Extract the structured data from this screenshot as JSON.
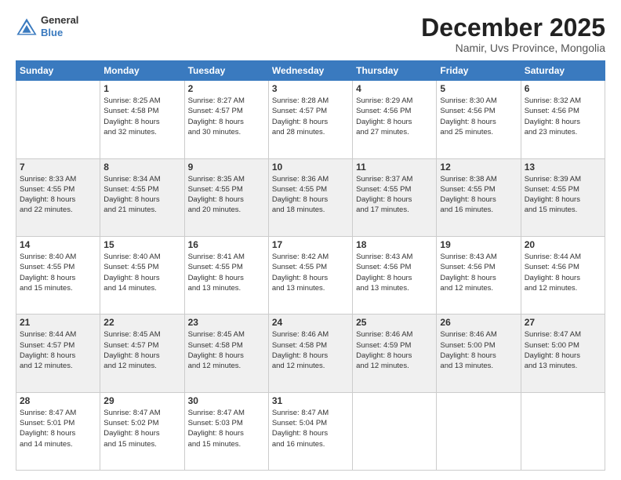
{
  "header": {
    "logo_general": "General",
    "logo_blue": "Blue",
    "month_title": "December 2025",
    "location": "Namir, Uvs Province, Mongolia"
  },
  "days_of_week": [
    "Sunday",
    "Monday",
    "Tuesday",
    "Wednesday",
    "Thursday",
    "Friday",
    "Saturday"
  ],
  "weeks": [
    [
      {
        "day": "",
        "content": ""
      },
      {
        "day": "1",
        "content": "Sunrise: 8:25 AM\nSunset: 4:58 PM\nDaylight: 8 hours\nand 32 minutes."
      },
      {
        "day": "2",
        "content": "Sunrise: 8:27 AM\nSunset: 4:57 PM\nDaylight: 8 hours\nand 30 minutes."
      },
      {
        "day": "3",
        "content": "Sunrise: 8:28 AM\nSunset: 4:57 PM\nDaylight: 8 hours\nand 28 minutes."
      },
      {
        "day": "4",
        "content": "Sunrise: 8:29 AM\nSunset: 4:56 PM\nDaylight: 8 hours\nand 27 minutes."
      },
      {
        "day": "5",
        "content": "Sunrise: 8:30 AM\nSunset: 4:56 PM\nDaylight: 8 hours\nand 25 minutes."
      },
      {
        "day": "6",
        "content": "Sunrise: 8:32 AM\nSunset: 4:56 PM\nDaylight: 8 hours\nand 23 minutes."
      }
    ],
    [
      {
        "day": "7",
        "content": "Sunrise: 8:33 AM\nSunset: 4:55 PM\nDaylight: 8 hours\nand 22 minutes."
      },
      {
        "day": "8",
        "content": "Sunrise: 8:34 AM\nSunset: 4:55 PM\nDaylight: 8 hours\nand 21 minutes."
      },
      {
        "day": "9",
        "content": "Sunrise: 8:35 AM\nSunset: 4:55 PM\nDaylight: 8 hours\nand 20 minutes."
      },
      {
        "day": "10",
        "content": "Sunrise: 8:36 AM\nSunset: 4:55 PM\nDaylight: 8 hours\nand 18 minutes."
      },
      {
        "day": "11",
        "content": "Sunrise: 8:37 AM\nSunset: 4:55 PM\nDaylight: 8 hours\nand 17 minutes."
      },
      {
        "day": "12",
        "content": "Sunrise: 8:38 AM\nSunset: 4:55 PM\nDaylight: 8 hours\nand 16 minutes."
      },
      {
        "day": "13",
        "content": "Sunrise: 8:39 AM\nSunset: 4:55 PM\nDaylight: 8 hours\nand 15 minutes."
      }
    ],
    [
      {
        "day": "14",
        "content": "Sunrise: 8:40 AM\nSunset: 4:55 PM\nDaylight: 8 hours\nand 15 minutes."
      },
      {
        "day": "15",
        "content": "Sunrise: 8:40 AM\nSunset: 4:55 PM\nDaylight: 8 hours\nand 14 minutes."
      },
      {
        "day": "16",
        "content": "Sunrise: 8:41 AM\nSunset: 4:55 PM\nDaylight: 8 hours\nand 13 minutes."
      },
      {
        "day": "17",
        "content": "Sunrise: 8:42 AM\nSunset: 4:55 PM\nDaylight: 8 hours\nand 13 minutes."
      },
      {
        "day": "18",
        "content": "Sunrise: 8:43 AM\nSunset: 4:56 PM\nDaylight: 8 hours\nand 13 minutes."
      },
      {
        "day": "19",
        "content": "Sunrise: 8:43 AM\nSunset: 4:56 PM\nDaylight: 8 hours\nand 12 minutes."
      },
      {
        "day": "20",
        "content": "Sunrise: 8:44 AM\nSunset: 4:56 PM\nDaylight: 8 hours\nand 12 minutes."
      }
    ],
    [
      {
        "day": "21",
        "content": "Sunrise: 8:44 AM\nSunset: 4:57 PM\nDaylight: 8 hours\nand 12 minutes."
      },
      {
        "day": "22",
        "content": "Sunrise: 8:45 AM\nSunset: 4:57 PM\nDaylight: 8 hours\nand 12 minutes."
      },
      {
        "day": "23",
        "content": "Sunrise: 8:45 AM\nSunset: 4:58 PM\nDaylight: 8 hours\nand 12 minutes."
      },
      {
        "day": "24",
        "content": "Sunrise: 8:46 AM\nSunset: 4:58 PM\nDaylight: 8 hours\nand 12 minutes."
      },
      {
        "day": "25",
        "content": "Sunrise: 8:46 AM\nSunset: 4:59 PM\nDaylight: 8 hours\nand 12 minutes."
      },
      {
        "day": "26",
        "content": "Sunrise: 8:46 AM\nSunset: 5:00 PM\nDaylight: 8 hours\nand 13 minutes."
      },
      {
        "day": "27",
        "content": "Sunrise: 8:47 AM\nSunset: 5:00 PM\nDaylight: 8 hours\nand 13 minutes."
      }
    ],
    [
      {
        "day": "28",
        "content": "Sunrise: 8:47 AM\nSunset: 5:01 PM\nDaylight: 8 hours\nand 14 minutes."
      },
      {
        "day": "29",
        "content": "Sunrise: 8:47 AM\nSunset: 5:02 PM\nDaylight: 8 hours\nand 15 minutes."
      },
      {
        "day": "30",
        "content": "Sunrise: 8:47 AM\nSunset: 5:03 PM\nDaylight: 8 hours\nand 15 minutes."
      },
      {
        "day": "31",
        "content": "Sunrise: 8:47 AM\nSunset: 5:04 PM\nDaylight: 8 hours\nand 16 minutes."
      },
      {
        "day": "",
        "content": ""
      },
      {
        "day": "",
        "content": ""
      },
      {
        "day": "",
        "content": ""
      }
    ]
  ]
}
